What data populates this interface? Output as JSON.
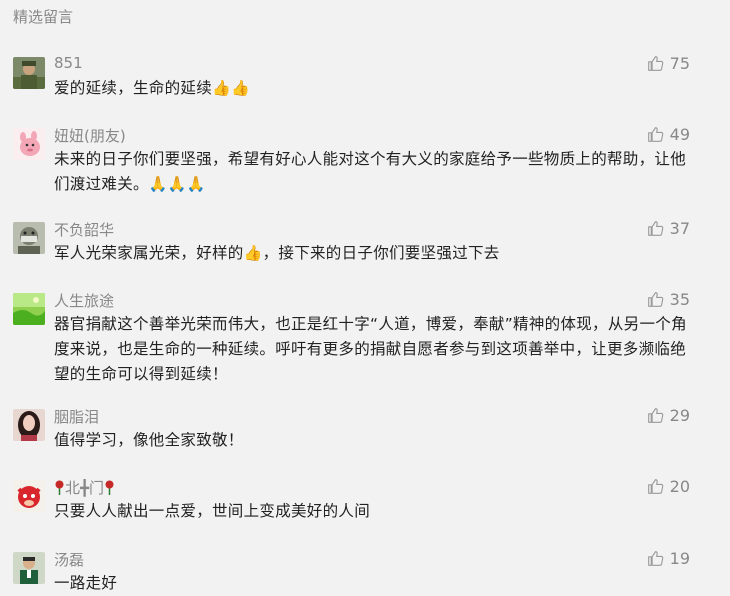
{
  "section_title": "精选留言",
  "comments": [
    {
      "nickname": "851",
      "likes": "75",
      "text": "爱的延续，生命的延续",
      "emoji": "👍👍",
      "avatar": "soldier-photo"
    },
    {
      "nickname": "妞妞(朋友)",
      "likes": "49",
      "text": "未来的日子你们要坚强，希望有好心人能对这个有大义的家庭给予一些物质上的帮助，让他们渡过难关。",
      "emoji": "🙏🙏🙏",
      "avatar": "pink-cartoon"
    },
    {
      "nickname": "不负韶华",
      "likes": "37",
      "text_before": "军人光荣家属光荣，好样的",
      "emoji": "👍",
      "text_after": "，接下来的日子你们要坚强过下去",
      "avatar": "masked-person"
    },
    {
      "nickname": "人生旅途",
      "likes": "35",
      "text": "器官捐献这个善举光荣而伟大，也正是红十字“人道，博爱，奉献”精神的体现，从另一个角度来说，也是生命的一种延续。呼吁有更多的捐献自愿者参与到这项善举中，让更多濒临绝望的生命可以得到延续！",
      "avatar": "green-landscape"
    },
    {
      "nickname": "胭脂泪",
      "likes": "29",
      "text": "值得学习，像他全家致敬！",
      "avatar": "woman-portrait"
    },
    {
      "nickname": "北╋门",
      "likes": "20",
      "text": "只要人人献出一点爱，世间上变成美好的人间",
      "avatar": "red-cartoon"
    },
    {
      "nickname": "汤磊",
      "likes": "19",
      "text": "一路走好",
      "avatar": "student-photo"
    }
  ],
  "colors": {
    "background": "#f2f2f2",
    "nickname": "#888888",
    "text": "#222222"
  }
}
